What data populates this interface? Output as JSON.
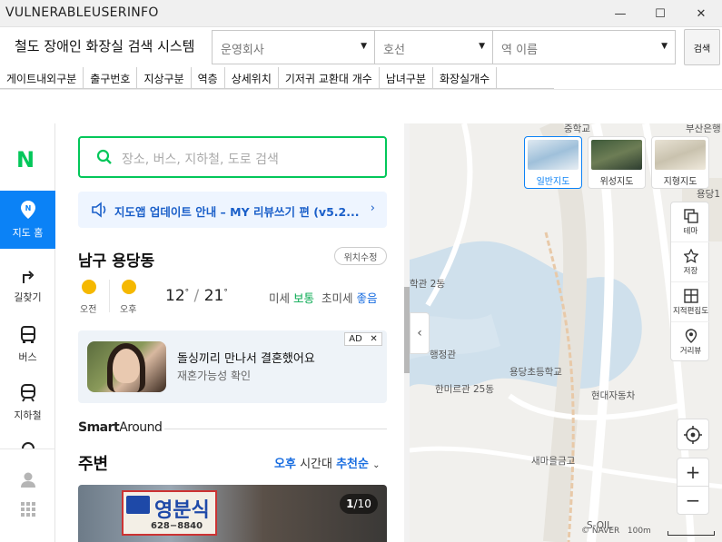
{
  "window": {
    "title": "VULNERABLEUSERINFO",
    "minimize": "—",
    "maximize": "☐",
    "close": "✕"
  },
  "header": {
    "app_title": "철도 장애인 화장실 검색 시스템",
    "operator_placeholder": "운영회사",
    "line_placeholder": "호선",
    "station_placeholder": "역 이름",
    "search_label": "검색"
  },
  "columns": [
    "게이트내외구분",
    "출구번호",
    "지상구분",
    "역층",
    "상세위치",
    "기저귀 교환대 개수",
    "남녀구분",
    "화장실개수"
  ],
  "sidebar": {
    "logo": "N",
    "items": [
      {
        "label": "지도 홈",
        "icon": "map-pin-icon"
      },
      {
        "label": "길찾기",
        "icon": "directions-icon"
      },
      {
        "label": "버스",
        "icon": "bus-icon"
      },
      {
        "label": "지하철",
        "icon": "subway-icon"
      }
    ]
  },
  "panel": {
    "search_placeholder": "장소, 버스, 지하철, 도로 검색",
    "notice": "지도앱 업데이트 안내 – MY 리뷰쓰기 편 (v5.2...",
    "place": "남구 용당동",
    "loc_button": "위치수정",
    "weather": {
      "am_label": "오전",
      "pm_label": "오후",
      "temp_low": "12",
      "temp_high": "21",
      "deg": "°",
      "slash": "/",
      "dust_label": "미세",
      "dust_value": "보통",
      "fine_dust_label": "초미세",
      "fine_dust_value": "좋음"
    },
    "ad": {
      "title": "돌싱끼리 만나서 결혼했어요",
      "subtitle": "재혼가능성 확인",
      "tag": "AD",
      "close": "✕"
    },
    "smart_around": {
      "bold": "Smart",
      "rest": "Around"
    },
    "nearby": {
      "title": "주변",
      "time_prefix": "오후",
      "time_middle": "시간대",
      "time_suffix": "추천순"
    },
    "photo": {
      "sign_text": "영분식",
      "sign_tel": "628−8840",
      "counter_current": "1",
      "counter_total": "/10"
    }
  },
  "map": {
    "labels": [
      "중학교",
      "부산은행",
      "용당1",
      "학관 2동",
      "행정관",
      "용당초등학교",
      "한미르관 25동",
      "현대자동차",
      "새마을금고",
      "S-OIL"
    ],
    "map_types": [
      {
        "label": "일반지도",
        "active": true
      },
      {
        "label": "위성지도",
        "active": false
      },
      {
        "label": "지형지도",
        "active": false
      }
    ],
    "tools": [
      "테마",
      "저장",
      "지적편집도",
      "거리뷰"
    ],
    "zoom_in": "+",
    "zoom_out": "−",
    "footer": "© NAVER",
    "scale": "100m"
  },
  "colors": {
    "naver_green": "#03c75a",
    "active_blue": "#0b82f6"
  }
}
